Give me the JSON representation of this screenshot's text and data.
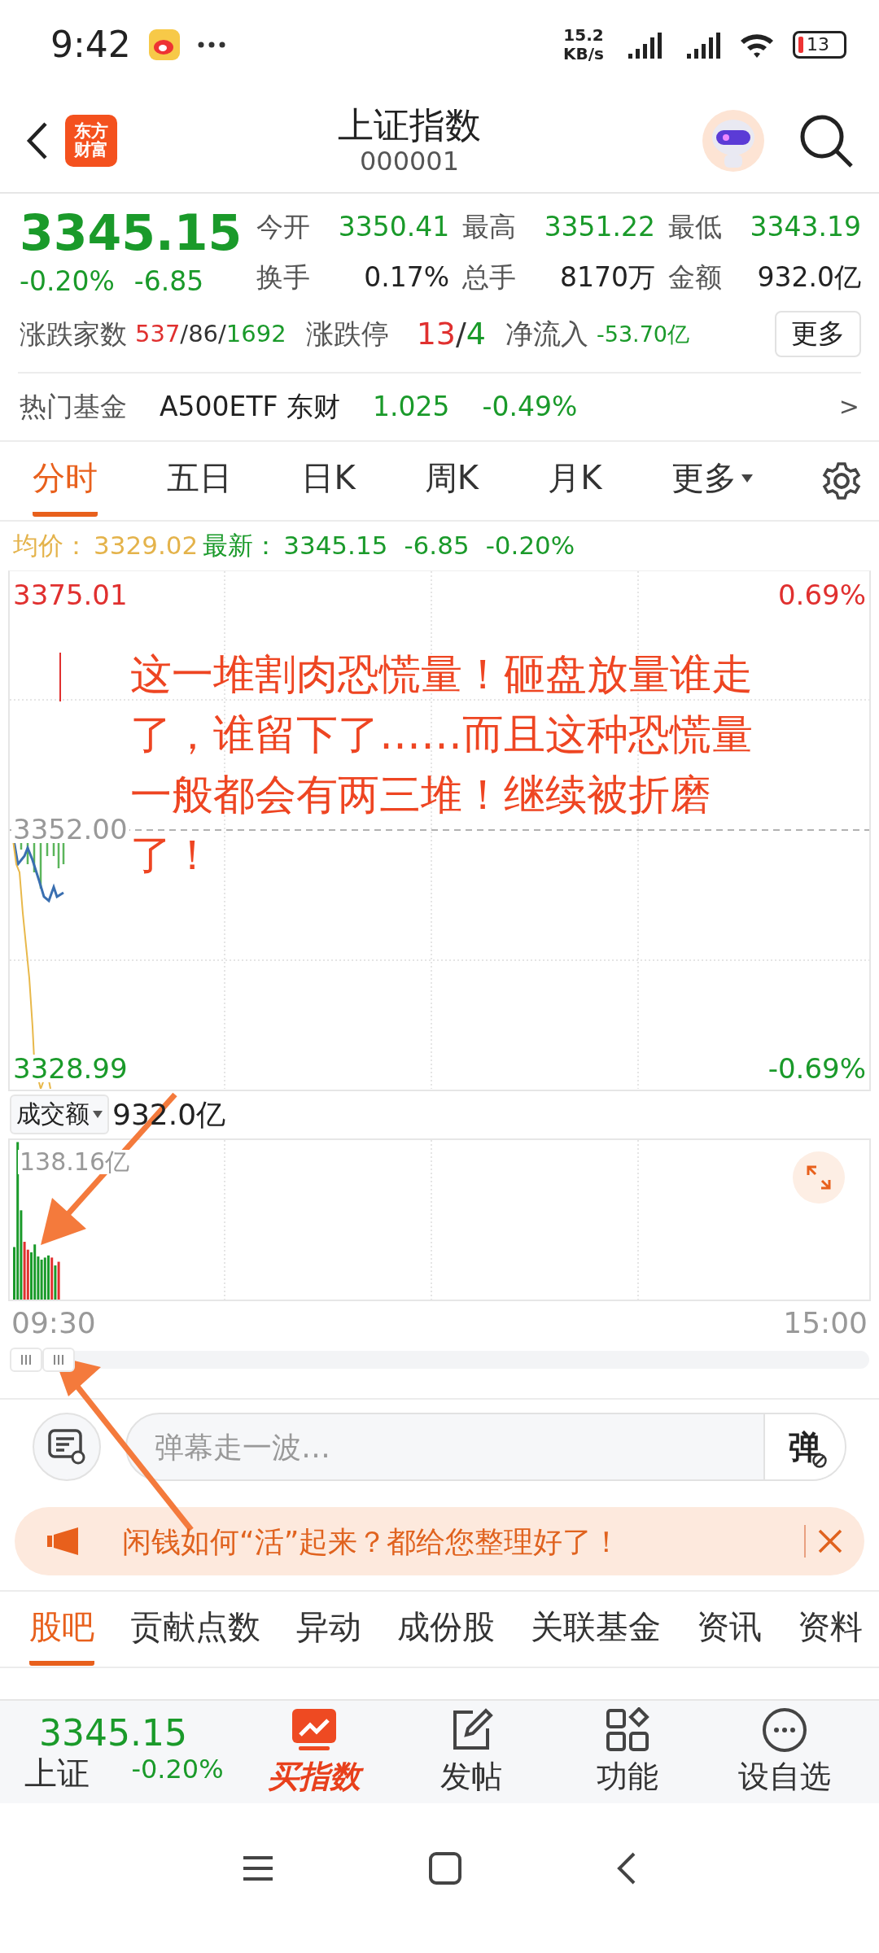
{
  "status_bar": {
    "time": "9:42",
    "speed_value": "15.2",
    "speed_unit": "KB/s",
    "battery": "13"
  },
  "header": {
    "logo_lines": [
      "东方",
      "财富"
    ],
    "title": "上证指数",
    "code": "000001"
  },
  "quote": {
    "price": "3345.15",
    "change_pct": "-0.20%",
    "change": "-6.85",
    "stats": [
      {
        "label": "今开",
        "value": "3350.41",
        "color": "#1a9a2a"
      },
      {
        "label": "最高",
        "value": "3351.22",
        "color": "#1a9a2a"
      },
      {
        "label": "最低",
        "value": "3343.19",
        "color": "#1a9a2a"
      },
      {
        "label": "换手",
        "value": "0.17%",
        "color": "#222222"
      },
      {
        "label": "总手",
        "value": "8170万",
        "color": "#222222"
      },
      {
        "label": "金额",
        "value": "932.0亿",
        "color": "#222222"
      }
    ]
  },
  "breadth": {
    "label": "涨跌家数",
    "up": "537",
    "sep_1": "/",
    "flat": "86",
    "sep_2": "/",
    "down": "1692",
    "limit_label": "涨跌停",
    "limit_up": "13",
    "limit_sep": "/",
    "limit_down": "4",
    "flow_label": "净流入",
    "flow": "-53.70亿",
    "more": "更多"
  },
  "hot_fund": {
    "label": "热门基金",
    "name": "A500ETF 东财",
    "price": "1.025",
    "change": "-0.49%",
    "arrow": ">"
  },
  "chart_tabs": [
    {
      "label": "分时",
      "selected": true
    },
    {
      "label": "五日",
      "selected": false
    },
    {
      "label": "日K",
      "selected": false
    },
    {
      "label": "周K",
      "selected": false
    },
    {
      "label": "月K",
      "selected": false
    },
    {
      "label": "更多",
      "selected": false,
      "dropdown": true
    }
  ],
  "summary": {
    "avg_label": "均价：",
    "avg": "3329.02",
    "latest_label": "最新：",
    "latest": "3345.15",
    "change": "-6.85",
    "pct": "-0.20%"
  },
  "chart": {
    "top_price": "3375.01",
    "top_pct": "0.69%",
    "mid_price": "3352.00",
    "bottom_price": "3328.99",
    "bottom_pct": "-0.69%"
  },
  "annotation": "这一堆割肉恐慌量！砸盘放量谁走了，谁留下了……而且这种恐慌量一般都会有两三堆！继续被折磨了！",
  "volume": {
    "selector": "成交额",
    "total": "932.0亿",
    "max": "138.16亿",
    "start_time": "09:30",
    "end_time": "15:00"
  },
  "danmaku": {
    "placeholder": "弹幕走一波…",
    "send": "弹"
  },
  "banner": {
    "text": "闲钱如何“活”起来？都给您整理好了！"
  },
  "forum_tabs": [
    {
      "label": "股吧",
      "selected": true
    },
    {
      "label": "贡献点数",
      "selected": false
    },
    {
      "label": "异动",
      "selected": false
    },
    {
      "label": "成份股",
      "selected": false
    },
    {
      "label": "关联基金",
      "selected": false
    },
    {
      "label": "资讯",
      "selected": false
    },
    {
      "label": "资料",
      "selected": false
    }
  ],
  "bottom_bar": {
    "price": "3345.15",
    "name": "上证",
    "pct": "-0.20%",
    "actions": [
      {
        "label": "买指数",
        "kind": "buy"
      },
      {
        "label": "发帖",
        "kind": "post"
      },
      {
        "label": "功能",
        "kind": "grid"
      },
      {
        "label": "设自选",
        "kind": "more"
      }
    ]
  }
}
